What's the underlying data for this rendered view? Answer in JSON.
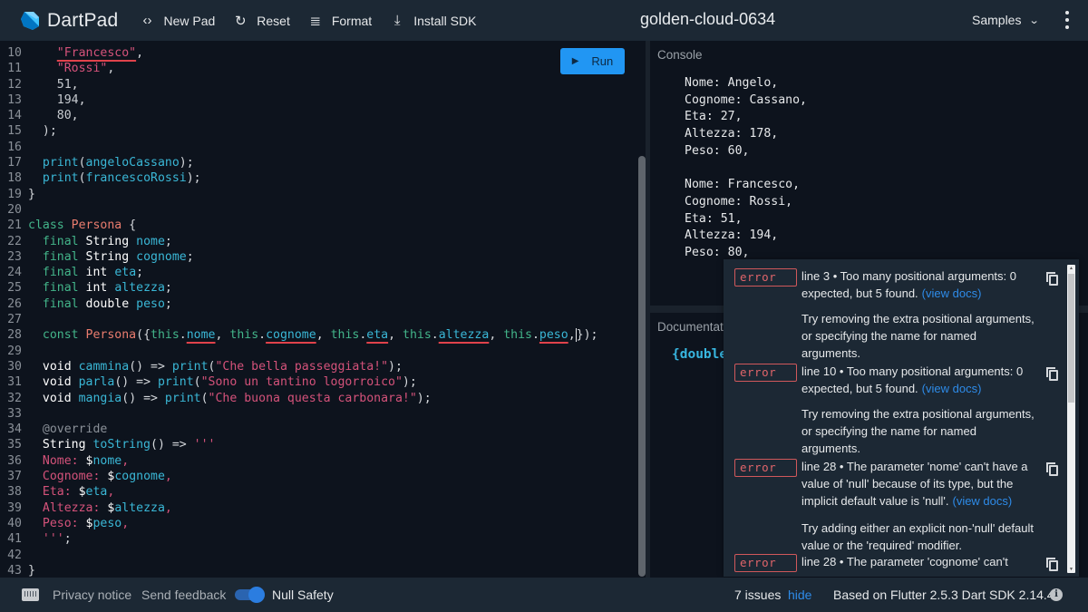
{
  "header": {
    "app_name": "DartPad",
    "buttons": [
      {
        "label": "New Pad",
        "icon": "code-brackets-icon"
      },
      {
        "label": "Reset",
        "icon": "refresh-icon"
      },
      {
        "label": "Format",
        "icon": "format-align-icon"
      },
      {
        "label": "Install SDK",
        "icon": "download-icon"
      }
    ],
    "pad_title": "golden-cloud-0634",
    "samples_label": "Samples"
  },
  "editor": {
    "run_label": "Run",
    "lines": [
      {
        "n": "10",
        "tokens": [
          [
            "plain",
            "    "
          ],
          [
            "str-err",
            "\"Francesco\""
          ],
          [
            "plain",
            ","
          ]
        ]
      },
      {
        "n": "11",
        "tokens": [
          [
            "plain",
            "    "
          ],
          [
            "str",
            "\"Rossi\""
          ],
          [
            "plain",
            ","
          ]
        ]
      },
      {
        "n": "12",
        "tokens": [
          [
            "plain",
            "    "
          ],
          [
            "num",
            "51"
          ],
          [
            "plain",
            ","
          ]
        ]
      },
      {
        "n": "13",
        "tokens": [
          [
            "plain",
            "    "
          ],
          [
            "num",
            "194"
          ],
          [
            "plain",
            ","
          ]
        ]
      },
      {
        "n": "14",
        "tokens": [
          [
            "plain",
            "    "
          ],
          [
            "num",
            "80"
          ],
          [
            "plain",
            ","
          ]
        ]
      },
      {
        "n": "15",
        "tokens": [
          [
            "plain",
            "  );"
          ]
        ]
      },
      {
        "n": "16",
        "tokens": []
      },
      {
        "n": "17",
        "tokens": [
          [
            "plain",
            "  "
          ],
          [
            "fn",
            "print"
          ],
          [
            "plain",
            "("
          ],
          [
            "fn",
            "angeloCassano"
          ],
          [
            "plain",
            ");"
          ]
        ]
      },
      {
        "n": "18",
        "tokens": [
          [
            "plain",
            "  "
          ],
          [
            "fn",
            "print"
          ],
          [
            "plain",
            "("
          ],
          [
            "fn",
            "francescoRossi"
          ],
          [
            "plain",
            ");"
          ]
        ]
      },
      {
        "n": "19",
        "tokens": [
          [
            "plain",
            "}"
          ]
        ]
      },
      {
        "n": "20",
        "tokens": []
      },
      {
        "n": "21",
        "tokens": [
          [
            "kw",
            "class"
          ],
          [
            "plain",
            " "
          ],
          [
            "cls",
            "Persona"
          ],
          [
            "plain",
            " {"
          ]
        ]
      },
      {
        "n": "22",
        "tokens": [
          [
            "plain",
            "  "
          ],
          [
            "kw",
            "final"
          ],
          [
            "plain",
            " "
          ],
          [
            "type",
            "String"
          ],
          [
            "plain",
            " "
          ],
          [
            "fn",
            "nome"
          ],
          [
            "plain",
            ";"
          ]
        ]
      },
      {
        "n": "23",
        "tokens": [
          [
            "plain",
            "  "
          ],
          [
            "kw",
            "final"
          ],
          [
            "plain",
            " "
          ],
          [
            "type",
            "String"
          ],
          [
            "plain",
            " "
          ],
          [
            "fn",
            "cognome"
          ],
          [
            "plain",
            ";"
          ]
        ]
      },
      {
        "n": "24",
        "tokens": [
          [
            "plain",
            "  "
          ],
          [
            "kw",
            "final"
          ],
          [
            "plain",
            " "
          ],
          [
            "type",
            "int"
          ],
          [
            "plain",
            " "
          ],
          [
            "fn",
            "eta"
          ],
          [
            "plain",
            ";"
          ]
        ]
      },
      {
        "n": "25",
        "tokens": [
          [
            "plain",
            "  "
          ],
          [
            "kw",
            "final"
          ],
          [
            "plain",
            " "
          ],
          [
            "type",
            "int"
          ],
          [
            "plain",
            " "
          ],
          [
            "fn",
            "altezza"
          ],
          [
            "plain",
            ";"
          ]
        ]
      },
      {
        "n": "26",
        "tokens": [
          [
            "plain",
            "  "
          ],
          [
            "kw",
            "final"
          ],
          [
            "plain",
            " "
          ],
          [
            "type",
            "double"
          ],
          [
            "plain",
            " "
          ],
          [
            "fn",
            "peso"
          ],
          [
            "plain",
            ";"
          ]
        ]
      },
      {
        "n": "27",
        "tokens": []
      },
      {
        "n": "28",
        "tokens": [
          [
            "plain",
            "  "
          ],
          [
            "kw",
            "const"
          ],
          [
            "plain",
            " "
          ],
          [
            "cls",
            "Persona"
          ],
          [
            "plain",
            "({"
          ],
          [
            "kw",
            "this"
          ],
          [
            "plain",
            "."
          ],
          [
            "fn-err",
            "nome"
          ],
          [
            "plain",
            ", "
          ],
          [
            "kw",
            "this"
          ],
          [
            "plain",
            "."
          ],
          [
            "fn-err",
            "cognome"
          ],
          [
            "plain",
            ", "
          ],
          [
            "kw",
            "this"
          ],
          [
            "plain",
            "."
          ],
          [
            "fn-err",
            "eta"
          ],
          [
            "plain",
            ", "
          ],
          [
            "kw",
            "this"
          ],
          [
            "plain",
            "."
          ],
          [
            "fn-err",
            "altezza"
          ],
          [
            "plain",
            ", "
          ],
          [
            "kw",
            "this"
          ],
          [
            "plain",
            "."
          ],
          [
            "fn-err",
            "peso"
          ],
          [
            "plain",
            ","
          ],
          [
            "cursor",
            ""
          ],
          [
            "plain",
            "});"
          ]
        ]
      },
      {
        "n": "29",
        "tokens": []
      },
      {
        "n": "30",
        "tokens": [
          [
            "plain",
            "  "
          ],
          [
            "type",
            "void"
          ],
          [
            "plain",
            " "
          ],
          [
            "fn",
            "cammina"
          ],
          [
            "plain",
            "() => "
          ],
          [
            "fn",
            "print"
          ],
          [
            "plain",
            "("
          ],
          [
            "str",
            "\"Che bella passeggiata!\""
          ],
          [
            "plain",
            ");"
          ]
        ]
      },
      {
        "n": "31",
        "tokens": [
          [
            "plain",
            "  "
          ],
          [
            "type",
            "void"
          ],
          [
            "plain",
            " "
          ],
          [
            "fn",
            "parla"
          ],
          [
            "plain",
            "() => "
          ],
          [
            "fn",
            "print"
          ],
          [
            "plain",
            "("
          ],
          [
            "str",
            "\"Sono un tantino logorroico\""
          ],
          [
            "plain",
            ");"
          ]
        ]
      },
      {
        "n": "32",
        "tokens": [
          [
            "plain",
            "  "
          ],
          [
            "type",
            "void"
          ],
          [
            "plain",
            " "
          ],
          [
            "fn",
            "mangia"
          ],
          [
            "plain",
            "() => "
          ],
          [
            "fn",
            "print"
          ],
          [
            "plain",
            "("
          ],
          [
            "str",
            "\"Che buona questa carbonara!\""
          ],
          [
            "plain",
            ");"
          ]
        ]
      },
      {
        "n": "33",
        "tokens": []
      },
      {
        "n": "34",
        "tokens": [
          [
            "plain",
            "  "
          ],
          [
            "meta",
            "@override"
          ]
        ]
      },
      {
        "n": "35",
        "tokens": [
          [
            "plain",
            "  "
          ],
          [
            "type",
            "String"
          ],
          [
            "plain",
            " "
          ],
          [
            "fn",
            "toString"
          ],
          [
            "plain",
            "() => "
          ],
          [
            "str",
            "'''"
          ]
        ]
      },
      {
        "n": "36",
        "tokens": [
          [
            "plain",
            "  "
          ],
          [
            "str",
            "Nome: "
          ],
          [
            "type",
            "$"
          ],
          [
            "fn",
            "nome"
          ],
          [
            "str",
            ","
          ]
        ]
      },
      {
        "n": "37",
        "tokens": [
          [
            "plain",
            "  "
          ],
          [
            "str",
            "Cognome: "
          ],
          [
            "type",
            "$"
          ],
          [
            "fn",
            "cognome"
          ],
          [
            "str",
            ","
          ]
        ]
      },
      {
        "n": "38",
        "tokens": [
          [
            "plain",
            "  "
          ],
          [
            "str",
            "Eta: "
          ],
          [
            "type",
            "$"
          ],
          [
            "fn",
            "eta"
          ],
          [
            "str",
            ","
          ]
        ]
      },
      {
        "n": "39",
        "tokens": [
          [
            "plain",
            "  "
          ],
          [
            "str",
            "Altezza: "
          ],
          [
            "type",
            "$"
          ],
          [
            "fn",
            "altezza"
          ],
          [
            "str",
            ","
          ]
        ]
      },
      {
        "n": "40",
        "tokens": [
          [
            "plain",
            "  "
          ],
          [
            "str",
            "Peso: "
          ],
          [
            "type",
            "$"
          ],
          [
            "fn",
            "peso"
          ],
          [
            "str",
            ","
          ]
        ]
      },
      {
        "n": "41",
        "tokens": [
          [
            "plain",
            "  "
          ],
          [
            "str",
            "'''"
          ],
          [
            "plain",
            ";"
          ]
        ]
      },
      {
        "n": "42",
        "tokens": []
      },
      {
        "n": "43",
        "tokens": [
          [
            "plain",
            "}"
          ]
        ]
      }
    ]
  },
  "console": {
    "label": "Console",
    "output": "Nome: Angelo,\nCognome: Cassano,\nEta: 27,\nAltezza: 178,\nPeso: 60,\n\nNome: Francesco,\nCognome: Rossi,\nEta: 51,\nAltezza: 194,\nPeso: 80,"
  },
  "documentation": {
    "label": "Documentation",
    "signature": "{double"
  },
  "issues": [
    {
      "severity": "error",
      "message": "line 3 • Too many positional arguments: 0 expected, but 5 found.",
      "docs_link": "(view docs)",
      "fix": "Try removing the extra positional arguments, or specifying the name for named arguments."
    },
    {
      "severity": "error",
      "message": "line 10 • Too many positional arguments: 0 expected, but 5 found.",
      "docs_link": "(view docs)",
      "fix": "Try removing the extra positional arguments, or specifying the name for named arguments."
    },
    {
      "severity": "error",
      "message": "line 28 • The parameter 'nome' can't have a value of 'null' because of its type, but the implicit default value is 'null'.",
      "docs_link": "(view docs)",
      "fix": "Try adding either an explicit non-'null' default value or the 'required' modifier."
    },
    {
      "severity": "error",
      "message": "line 28 • The parameter 'cognome' can't",
      "docs_link": "",
      "fix": ""
    }
  ],
  "footer": {
    "privacy_label": "Privacy notice",
    "feedback_label": "Send feedback",
    "null_safety_label": "Null Safety",
    "null_safety_on": true,
    "issues_count": "7 issues",
    "hide_label": "hide",
    "version": "Based on Flutter 2.5.3 Dart SDK 2.14.4"
  },
  "colors": {
    "accent": "#2196f3",
    "error": "#e0424b",
    "link": "#2e8be8"
  }
}
